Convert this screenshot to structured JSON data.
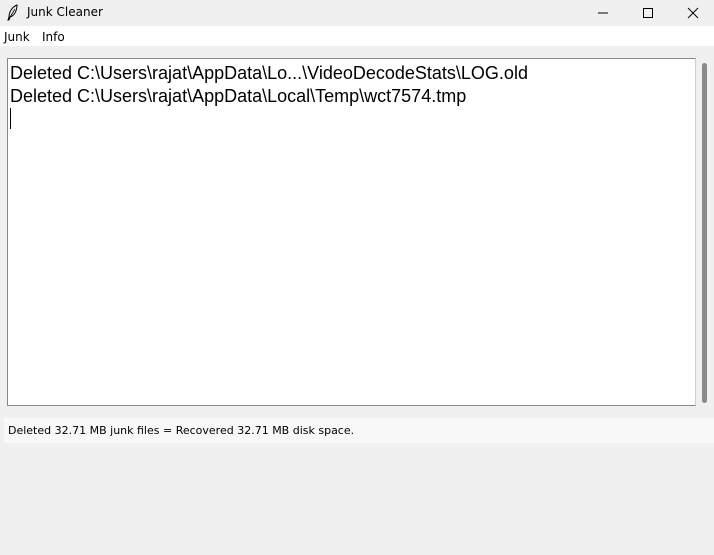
{
  "window": {
    "title": "Junk Cleaner"
  },
  "menu": {
    "items": [
      "Junk",
      "Info"
    ]
  },
  "log": {
    "lines": [
      "Deleted C:\\Users\\rajat\\AppData\\Lo...\\VideoDecodeStats\\LOG.old",
      "Deleted C:\\Users\\rajat\\AppData\\Local\\Temp\\wct7574.tmp"
    ]
  },
  "status": {
    "text": "Deleted 32.71 MB junk files = Recovered 32.71 MB disk space."
  },
  "icons": {
    "app": "feather-icon",
    "minimize": "minimize-icon",
    "maximize": "maximize-icon",
    "close": "close-icon"
  }
}
